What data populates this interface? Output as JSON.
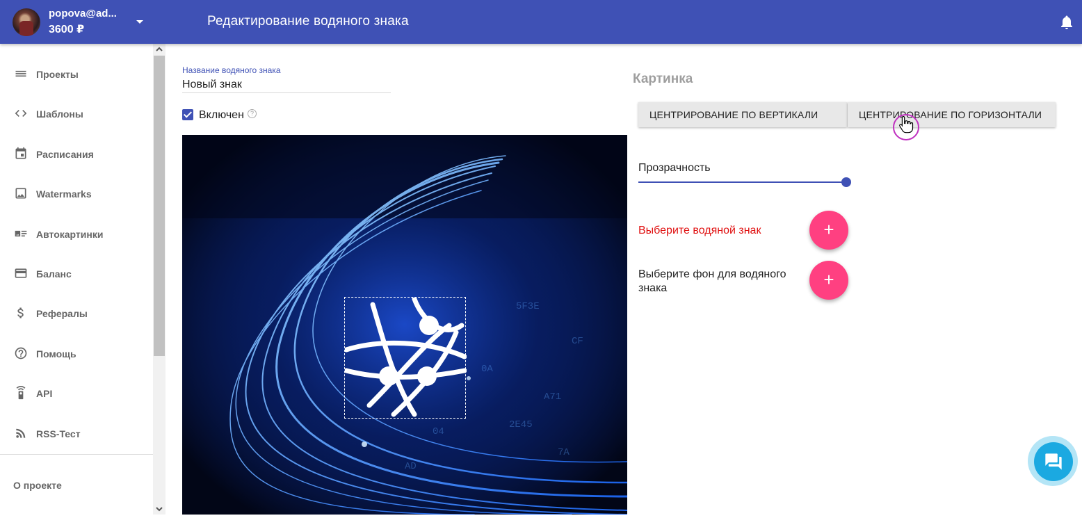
{
  "header": {
    "user_email": "popova@ad...",
    "user_balance": "3600 ₽",
    "title": "Редактирование водяного знака",
    "bell_icon": "bell-icon"
  },
  "sidebar": {
    "items": [
      {
        "label": "Проекты",
        "icon": "list-icon"
      },
      {
        "label": "Шаблоны",
        "icon": "code-icon"
      },
      {
        "label": "Расписания",
        "icon": "calendar-icon"
      },
      {
        "label": "Watermarks",
        "icon": "image-icon"
      },
      {
        "label": "Автокартинки",
        "icon": "picture-text-icon"
      },
      {
        "label": "Баланс",
        "icon": "credit-card-icon"
      },
      {
        "label": "Рефералы",
        "icon": "dollar-icon"
      },
      {
        "label": "Помощь",
        "icon": "help-icon"
      },
      {
        "label": "API",
        "icon": "remote-icon"
      },
      {
        "label": "RSS-Тест",
        "icon": "rss-icon"
      }
    ],
    "about": "О проекте"
  },
  "form": {
    "name_label": "Название водяного знака",
    "name_value": "Новый знак",
    "enabled_label": "Включен",
    "enabled_checked": true,
    "help_glyph": "?"
  },
  "picture": {
    "title": "Картинка",
    "center_vertical": "ЦЕНТРИРОВАНИЕ ПО ВЕРТИКАЛИ",
    "center_horizontal": "ЦЕНТРИРОВАНИЕ ПО ГОРИЗОНТАЛИ",
    "opacity_label": "Прозрачность",
    "opacity_value": 1.0,
    "select_watermark": "Выберите водяной знак",
    "select_background": "Выберите фон для водяного знака",
    "add_glyph": "+"
  },
  "colors": {
    "primary": "#3f51b5",
    "accent": "#ff4081",
    "error": "#e01010",
    "chat": "#1ba9e1"
  }
}
